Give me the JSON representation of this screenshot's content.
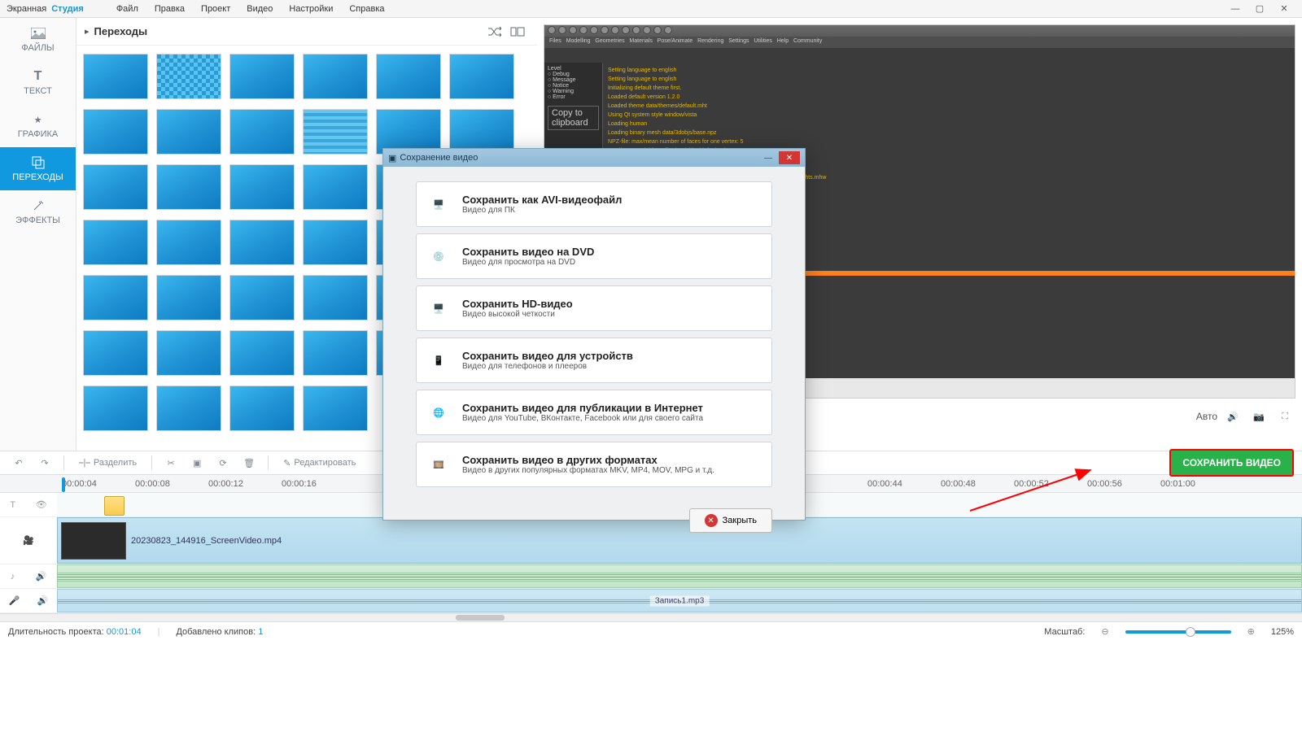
{
  "app": {
    "name": "Экранная",
    "suffix": "Студия"
  },
  "menu": [
    "Файл",
    "Правка",
    "Проект",
    "Видео",
    "Настройки",
    "Справка"
  ],
  "sidebar": {
    "items": [
      {
        "label": "ФАЙЛЫ",
        "icon": "image-icon"
      },
      {
        "label": "ТЕКСТ",
        "icon": "text-icon"
      },
      {
        "label": "ГРАФИКА",
        "icon": "star-icon"
      },
      {
        "label": "ПЕРЕХОДЫ",
        "icon": "copy-icon"
      },
      {
        "label": "ЭФФЕКТЫ",
        "icon": "wand-icon"
      }
    ],
    "active_index": 3
  },
  "panel": {
    "title": "Переходы"
  },
  "preview": {
    "auto_label": "Авто"
  },
  "toolbar": {
    "split_label": "Разделить",
    "edit_label": "Редактировать",
    "save_video": "СОХРАНИТЬ ВИДЕО"
  },
  "timeline": {
    "ticks": [
      "00:00:04",
      "00:00:08",
      "00:00:12",
      "00:00:16",
      "",
      "",
      "",
      "",
      "",
      "",
      "",
      "00:00:44",
      "00:00:48",
      "00:00:52",
      "00:00:56",
      "00:01:00"
    ],
    "video_clip": "20230823_144916_ScreenVideo.mp4",
    "rec_clip": "Запись1.mp3"
  },
  "statusbar": {
    "duration_label": "Длительность проекта:",
    "duration_value": "00:01:04",
    "clips_label": "Добавлено клипов:",
    "clips_value": "1",
    "zoom_label": "Масштаб:",
    "zoom_value": "125%"
  },
  "dialog": {
    "title": "Сохранение видео",
    "options": [
      {
        "title": "Сохранить как AVI-видеофайл",
        "sub": "Видео для ПК"
      },
      {
        "title": "Сохранить видео на DVD",
        "sub": "Видео для просмотра на DVD"
      },
      {
        "title": "Сохранить HD-видео",
        "sub": "Видео высокой четкости"
      },
      {
        "title": "Сохранить видео для устройств",
        "sub": "Видео для телефонов и плееров"
      },
      {
        "title": "Сохранить видео для публикации в Интернет",
        "sub": "Видео для YouTube, ВКонтакте, Facebook или для своего сайта"
      },
      {
        "title": "Сохранить видео в других форматах",
        "sub": "Видео в других популярных форматах MKV, MP4, MOV, MPG и т.д."
      }
    ],
    "close_label": "Закрыть"
  }
}
